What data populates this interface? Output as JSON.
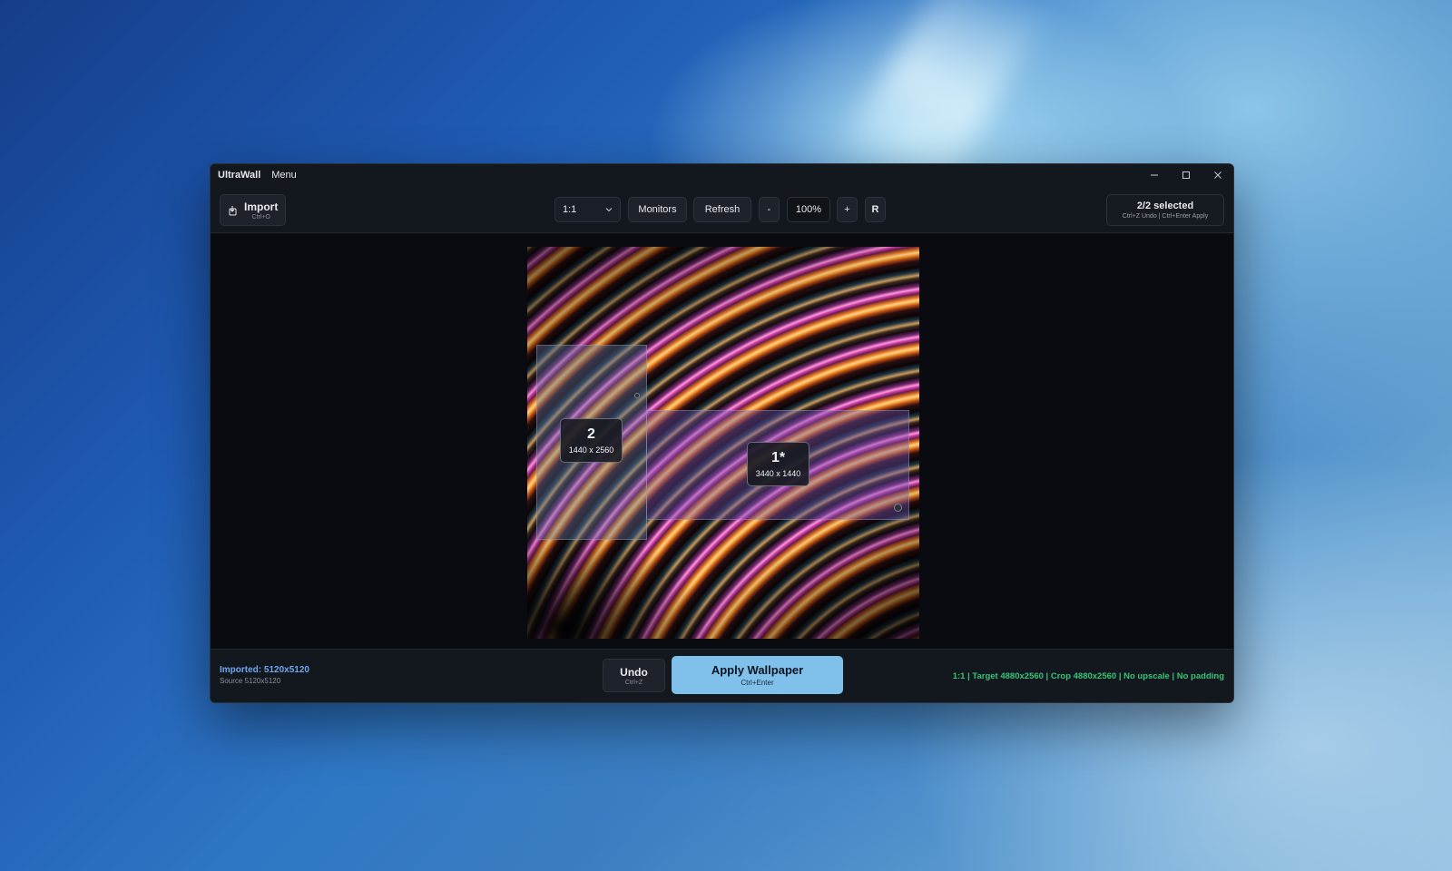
{
  "window": {
    "app_name": "UltraWall",
    "menu_label": "Menu"
  },
  "toolbar": {
    "import_label": "Import",
    "import_shortcut": "Ctrl+O",
    "ratio_value": "1:1",
    "monitors_label": "Monitors",
    "refresh_label": "Refresh",
    "zoom_minus_label": "-",
    "zoom_level": "100%",
    "zoom_plus_label": "+",
    "reset_label": "R",
    "selection_count": "2/2 selected",
    "selection_hint": "Ctrl+Z Undo  |  Ctrl+Enter Apply"
  },
  "monitors": [
    {
      "number": "2",
      "resolution": "1440 x 2560"
    },
    {
      "number": "1*",
      "resolution": "3440 x 1440"
    }
  ],
  "bottom": {
    "imported": "Imported: 5120x5120",
    "source": "Source 5120x5120",
    "undo_label": "Undo",
    "undo_shortcut": "Ctrl+Z",
    "apply_label": "Apply Wallpaper",
    "apply_shortcut": "Ctrl+Enter",
    "status": "1:1 | Target 4880x2560 | Crop 4880x2560 | No upscale | No padding"
  },
  "colors": {
    "accent": "#7fc1eb",
    "status_green": "#37c47a",
    "imported_blue": "#6fa8f0",
    "window_bg": "#0b0e14"
  },
  "icons": [
    "import-icon",
    "chevron-down-icon",
    "minimize-icon",
    "maximize-icon",
    "close-icon"
  ]
}
